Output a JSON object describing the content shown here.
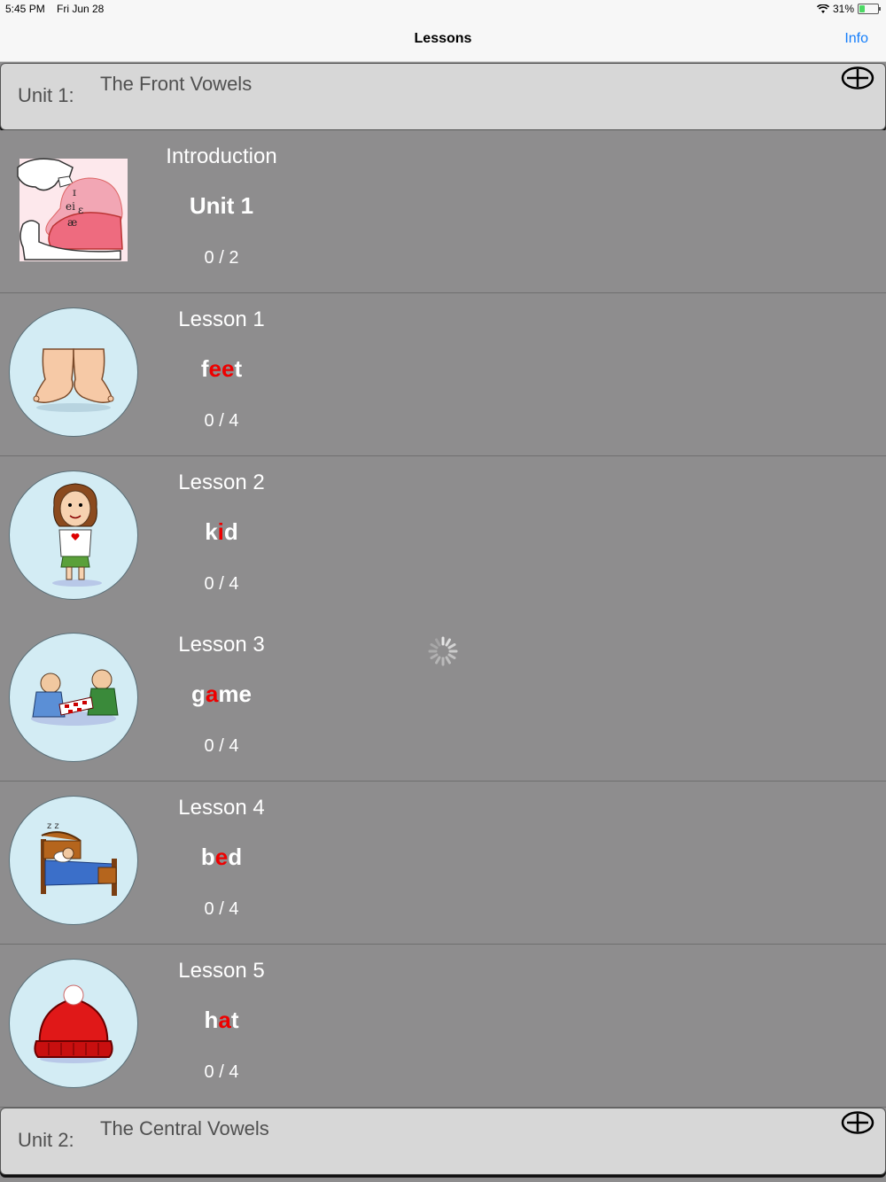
{
  "status_bar": {
    "time": "5:45 PM",
    "date": "Fri Jun 28",
    "battery": "31%"
  },
  "nav": {
    "title": "Lessons",
    "info_label": "Info"
  },
  "units": [
    {
      "label": "Unit 1:",
      "name": "The Front Vowels"
    },
    {
      "label": "Unit 2:",
      "name": "The Central Vowels"
    }
  ],
  "intro": {
    "title": "Introduction",
    "subtitle": "Unit 1",
    "progress": "0 / 2"
  },
  "lessons": [
    {
      "title": "Lesson 1",
      "word_pre": "f",
      "word_hl": "ee",
      "word_post": "t",
      "progress": "0 / 4",
      "icon": "feet-icon"
    },
    {
      "title": "Lesson 2",
      "word_pre": "k",
      "word_hl": "i",
      "word_post": "d",
      "progress": "0 / 4",
      "icon": "kid-icon"
    },
    {
      "title": "Lesson 3",
      "word_pre": "g",
      "word_hl": "a",
      "word_post": "me",
      "progress": "0 / 4",
      "icon": "game-icon"
    },
    {
      "title": "Lesson 4",
      "word_pre": "b",
      "word_hl": "e",
      "word_post": "d",
      "progress": "0 / 4",
      "icon": "bed-icon"
    },
    {
      "title": "Lesson 5",
      "word_pre": "h",
      "word_hl": "a",
      "word_post": "t",
      "progress": "0 / 4",
      "icon": "hat-icon"
    }
  ],
  "colors": {
    "accent": "#147efb",
    "highlight": "#e00000",
    "row_bg": "#8e8d8e",
    "unit_bg": "#d7d7d7"
  }
}
